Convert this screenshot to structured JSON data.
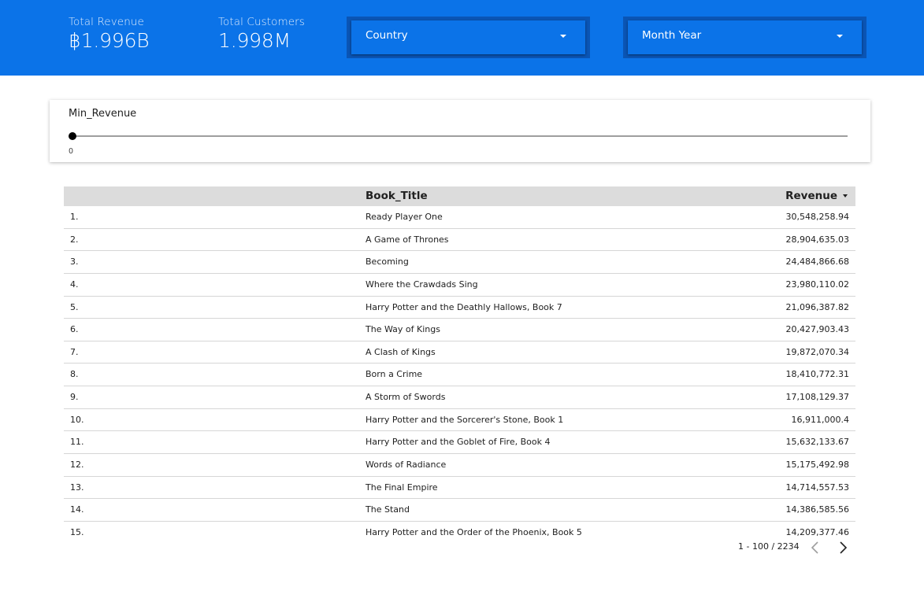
{
  "header": {
    "kpis": [
      {
        "label": "Total Revenue",
        "value": "฿1.996B"
      },
      {
        "label": "Total Customers",
        "value": "1.998M"
      }
    ],
    "filters": [
      {
        "label": "Country",
        "icon": "caret-down-icon"
      },
      {
        "label": "Month Year",
        "icon": "caret-down-icon"
      }
    ]
  },
  "slider": {
    "title": "Min_Revenue",
    "value": "0",
    "level": 0
  },
  "table": {
    "columns": {
      "title": "Book_Title",
      "revenue": "Revenue",
      "sort_icon": "sort-desc-icon"
    },
    "rows": [
      {
        "index": "1.",
        "title": "Ready Player One",
        "revenue": "30,548,258.94"
      },
      {
        "index": "2.",
        "title": "A Game of Thrones",
        "revenue": "28,904,635.03"
      },
      {
        "index": "3.",
        "title": "Becoming",
        "revenue": "24,484,866.68"
      },
      {
        "index": "4.",
        "title": "Where the Crawdads Sing",
        "revenue": "23,980,110.02"
      },
      {
        "index": "5.",
        "title": "Harry Potter and the Deathly Hallows, Book 7",
        "revenue": "21,096,387.82"
      },
      {
        "index": "6.",
        "title": "The Way of Kings",
        "revenue": "20,427,903.43"
      },
      {
        "index": "7.",
        "title": "A Clash of Kings",
        "revenue": "19,872,070.34"
      },
      {
        "index": "8.",
        "title": "Born a Crime",
        "revenue": "18,410,772.31"
      },
      {
        "index": "9.",
        "title": "A Storm of Swords",
        "revenue": "17,108,129.37"
      },
      {
        "index": "10.",
        "title": "Harry Potter and the Sorcerer's Stone, Book 1",
        "revenue": "16,911,000.4"
      },
      {
        "index": "11.",
        "title": "Harry Potter and the Goblet of Fire, Book 4",
        "revenue": "15,632,133.67"
      },
      {
        "index": "12.",
        "title": "Words of Radiance",
        "revenue": "15,175,492.98"
      },
      {
        "index": "13.",
        "title": "The Final Empire",
        "revenue": "14,714,557.53"
      },
      {
        "index": "14.",
        "title": "The Stand",
        "revenue": "14,386,585.56"
      },
      {
        "index": "15.",
        "title": "Harry Potter and the Order of the Phoenix, Book 5",
        "revenue": "14,209,377.46"
      }
    ]
  },
  "pagination": {
    "range": "1 - 100 / 2234",
    "prev_icon": "chevron-left-icon",
    "next_icon": "chevron-right-icon"
  },
  "colors": {
    "header_bg": "#0b73e8",
    "dropdown_frame": "#0a55b5",
    "table_header_bg": "#dcdcdc",
    "text": "#212121"
  }
}
